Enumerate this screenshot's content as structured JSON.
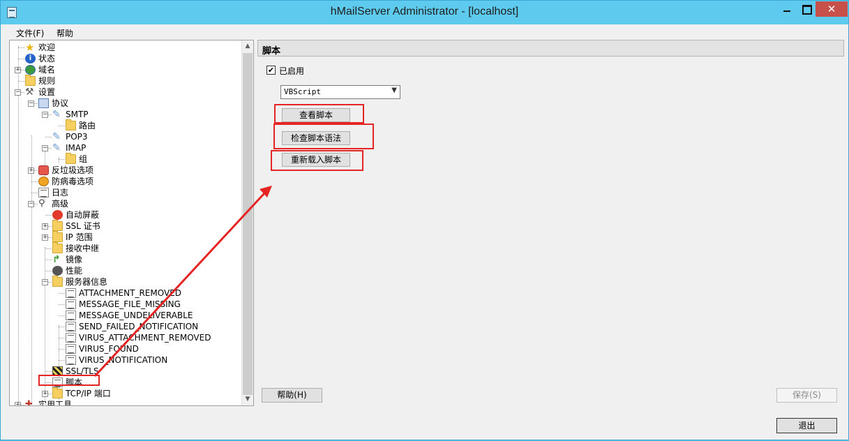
{
  "window": {
    "title": "hMailServer Administrator - [localhost]",
    "close_glyph": "✕"
  },
  "menu": [
    "文件(F)",
    "帮助"
  ],
  "tree": [
    {
      "label": "欢迎",
      "icon": "star-icon"
    },
    {
      "label": "状态",
      "icon": "info-icon"
    },
    {
      "label": "域名",
      "icon": "globe-icon"
    },
    {
      "label": "规则",
      "icon": "folder-icon"
    },
    {
      "label": "设置",
      "icon": "tools-icon"
    },
    {
      "label": "协议",
      "icon": "protocol-icon"
    },
    {
      "label": "SMTP",
      "icon": "feather-icon"
    },
    {
      "label": "路由",
      "icon": "folder-icon"
    },
    {
      "label": "POP3",
      "icon": "feather-icon"
    },
    {
      "label": "IMAP",
      "icon": "feather-icon"
    },
    {
      "label": "组",
      "icon": "folder-icon"
    },
    {
      "label": "反垃圾选项",
      "icon": "antispam-icon"
    },
    {
      "label": "防病毒选项",
      "icon": "antivirus-icon"
    },
    {
      "label": "日志",
      "icon": "document-icon"
    },
    {
      "label": "高级",
      "icon": "magnifier-icon"
    },
    {
      "label": "自动屏蔽",
      "icon": "block-icon"
    },
    {
      "label": "SSL 证书",
      "icon": "folder-icon"
    },
    {
      "label": "IP 范围",
      "icon": "folder-icon"
    },
    {
      "label": "接收中继",
      "icon": "folder-icon"
    },
    {
      "label": "镜像",
      "icon": "mirror-icon"
    },
    {
      "label": "性能",
      "icon": "performance-icon"
    },
    {
      "label": "服务器信息",
      "icon": "folder-icon"
    },
    {
      "label": "ATTACHMENT_REMOVED",
      "icon": "document-icon"
    },
    {
      "label": "MESSAGE_FILE_MISSING",
      "icon": "document-icon"
    },
    {
      "label": "MESSAGE_UNDELIVERABLE",
      "icon": "document-icon"
    },
    {
      "label": "SEND_FAILED_NOTIFICATION",
      "icon": "document-icon"
    },
    {
      "label": "VIRUS_ATTACHMENT_REMOVED",
      "icon": "document-icon"
    },
    {
      "label": "VIRUS_FOUND",
      "icon": "document-icon"
    },
    {
      "label": "VIRUS_NOTIFICATION",
      "icon": "document-icon"
    },
    {
      "label": "SSL/TLS",
      "icon": "ssl-icon"
    },
    {
      "label": "脚本",
      "icon": "script-icon"
    },
    {
      "label": "TCP/IP 端口",
      "icon": "folder-icon"
    },
    {
      "label": "实用工具",
      "icon": "utilities-icon"
    }
  ],
  "panel": {
    "title": "脚本",
    "enabled_label": "已启用",
    "enabled_checked": true,
    "check_glyph": "✔",
    "language_value": "VBScript",
    "view_script_label": "查看脚本",
    "check_syntax_label": "检查脚本语法",
    "reload_scripts_label": "重新载入脚本",
    "help_label": "帮助(H)",
    "save_label": "保存(S)",
    "exit_label": "退出"
  },
  "colors": {
    "title_bar": "#5ecbee",
    "close_button": "#c7504a",
    "highlight": "#e52524"
  }
}
